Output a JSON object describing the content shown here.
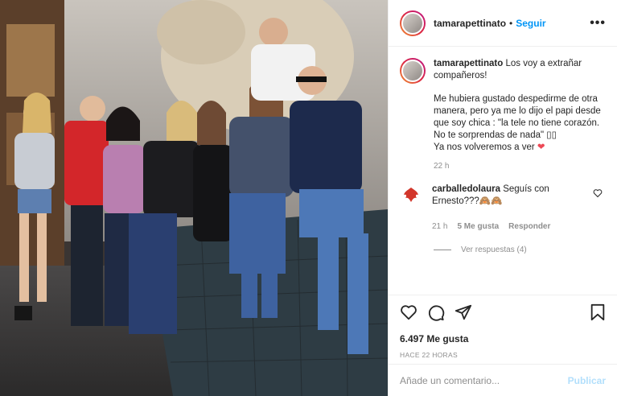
{
  "header": {
    "username": "tamarapettinato",
    "separator": "•",
    "follow_label": "Seguir",
    "more_label": "•••"
  },
  "caption": {
    "username": "tamarapettinato",
    "line1": "Los voy a extrañar compañeros!",
    "line2": "Me hubiera gustado despedirme de otra manera, pero ya me lo dijo el papi desde que soy chica : \"la tele no tiene corazón. No te sorprendas de nada\" ▯▯",
    "line3": "Ya nos volveremos a ver",
    "heart": "❤",
    "time": "22 h"
  },
  "comment": {
    "username": "carballedolaura",
    "text": "Seguís con Ernesto???🙈🙈",
    "time": "21 h",
    "likes": "5 Me gusta",
    "reply": "Responder",
    "view_replies": "Ver respuestas (4)"
  },
  "actions": {
    "likes": "6.497 Me gusta",
    "ago": "HACE 22 HORAS"
  },
  "add_comment": {
    "placeholder": "Añade un comentario...",
    "publish": "Publicar"
  },
  "colors": {
    "accent": "#0095f6",
    "publish_disabled": "#b2dffc",
    "heart": "#ed4956"
  },
  "icons": [
    "heart-icon",
    "comment-icon",
    "share-icon",
    "bookmark-icon",
    "small-heart-icon"
  ]
}
